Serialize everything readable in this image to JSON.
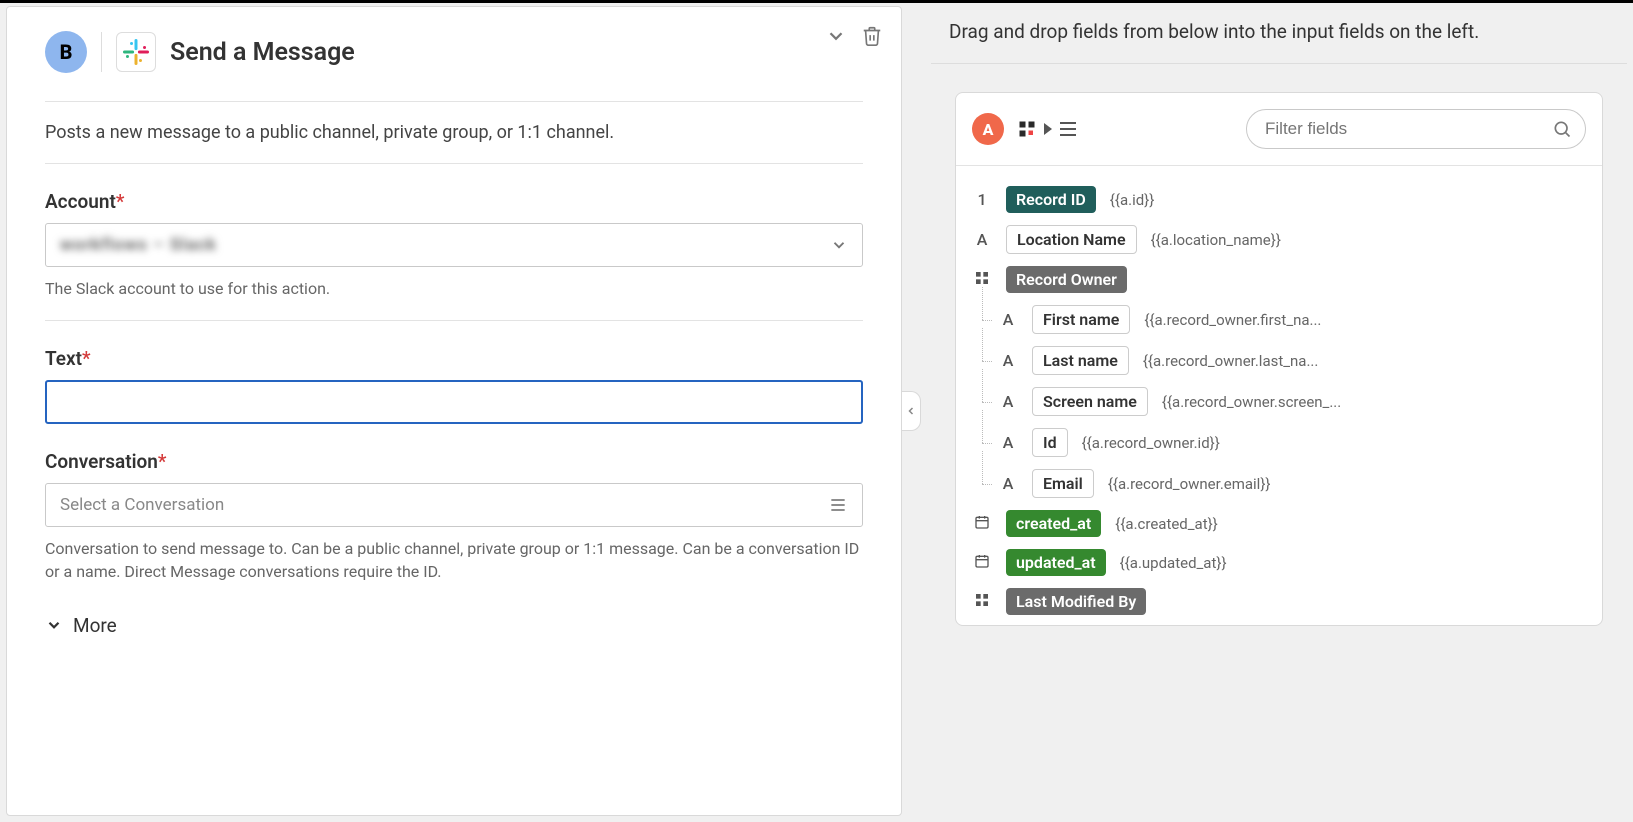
{
  "left": {
    "step_badge": "B",
    "title": "Send a Message",
    "description": "Posts a new message to a public channel, private group, or 1:1 channel.",
    "account": {
      "label": "Account",
      "value_masked": "workflows – Slack",
      "help": "The Slack account to use for this action."
    },
    "text": {
      "label": "Text",
      "value": ""
    },
    "conversation": {
      "label": "Conversation",
      "placeholder": "Select a Conversation",
      "help": "Conversation to send message to. Can be a public channel, private group or 1:1 message. Can be a conversation ID or a name. Direct Message conversations require the ID."
    },
    "more_label": "More"
  },
  "right": {
    "header": "Drag and drop fields from below into the input fields on the left.",
    "src_badge": "A",
    "filter_placeholder": "Filter fields",
    "fields": [
      {
        "type": "1",
        "pill_class": "dark",
        "label": "Record ID",
        "var": "{{a.id}}",
        "child": false
      },
      {
        "type": "A",
        "pill_class": "white",
        "label": "Location Name",
        "var": "{{a.location_name}}",
        "child": false
      },
      {
        "type": "grid",
        "pill_class": "grey",
        "label": "Record Owner",
        "var": "",
        "child": false
      },
      {
        "type": "A",
        "pill_class": "white",
        "label": "First name",
        "var": "{{a.record_owner.first_na...",
        "child": true
      },
      {
        "type": "A",
        "pill_class": "white",
        "label": "Last name",
        "var": "{{a.record_owner.last_na...",
        "child": true
      },
      {
        "type": "A",
        "pill_class": "white",
        "label": "Screen name",
        "var": "{{a.record_owner.screen_...",
        "child": true
      },
      {
        "type": "A",
        "pill_class": "white",
        "label": "Id",
        "var": "{{a.record_owner.id}}",
        "child": true
      },
      {
        "type": "A",
        "pill_class": "white",
        "label": "Email",
        "var": "{{a.record_owner.email}}",
        "child": true
      },
      {
        "type": "date",
        "pill_class": "green",
        "label": "created_at",
        "var": "{{a.created_at}}",
        "child": false
      },
      {
        "type": "date",
        "pill_class": "green",
        "label": "updated_at",
        "var": "{{a.updated_at}}",
        "child": false
      },
      {
        "type": "grid",
        "pill_class": "grey",
        "label": "Last Modified By",
        "var": "",
        "child": false
      }
    ]
  }
}
